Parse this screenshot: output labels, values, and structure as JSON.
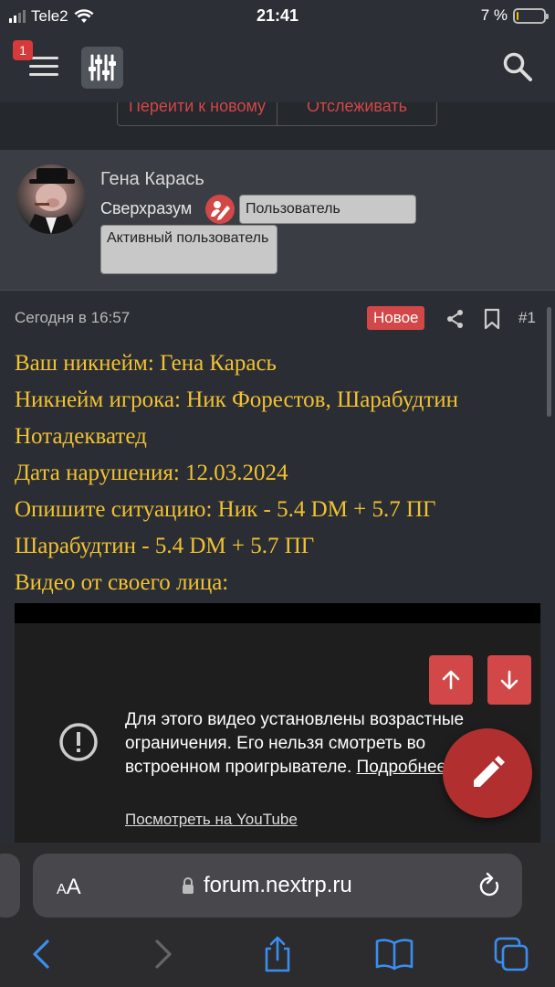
{
  "status_bar": {
    "carrier": "Tele2",
    "time": "21:41",
    "battery": "7 %",
    "battery_level": 0.07
  },
  "header": {
    "notification_count": "1",
    "icons": [
      "menu-icon",
      "filter-icon",
      "search-icon"
    ]
  },
  "top_buttons": {
    "goto_new": "Перейти к новому",
    "watch": "Отслеживать"
  },
  "user": {
    "name": "Гена Карась",
    "title": "Сверхразум",
    "badge1": "Пользователь",
    "badge2": "Активный пользователь"
  },
  "post": {
    "time": "Сегодня в 16:57",
    "new_badge": "Новое",
    "number": "#1",
    "lines": [
      "Ваш никнейм: Гена Карась",
      "Никнейм игрока: Ник Форестов, Шарабудтин Нотадекватед",
      "Дата нарушения: 12.03.2024",
      "Опишите ситуацию: Ник - 5.4 DM + 5.7 ПГ Шарабудтин - 5.4 DM + 5.7 ПГ",
      "Видео от своего лица:"
    ]
  },
  "video": {
    "message": "Для этого видео установлены возрастные ограничения. Его нельзя смотреть во встроенном проигрывателе.",
    "more_link": "Подробнее...",
    "youtube_link": "Посмотреть на YouTube"
  },
  "browser": {
    "aa_small": "A",
    "aa_large": "A",
    "url": "forum.nextrp.ru"
  },
  "colors": {
    "accent": "#d24747",
    "post_text": "#f1c232",
    "background": "#2a2d33"
  }
}
